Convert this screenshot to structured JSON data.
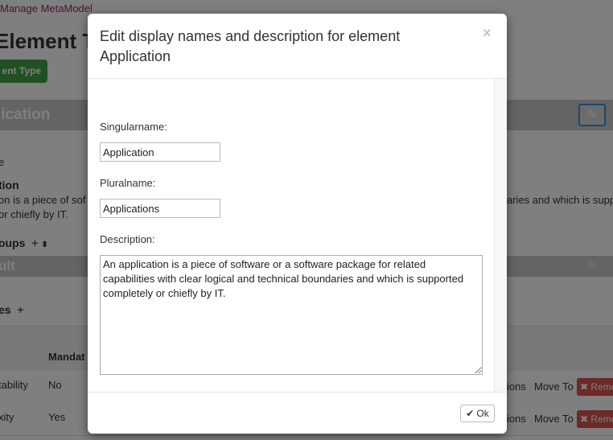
{
  "background": {
    "breadcrumb": "Manage MetaModel",
    "page_title": "Element Ty",
    "add_button_label": "ent Type",
    "section_header": "lication",
    "field_fragment_1": "e",
    "field_fragment_2": "tion",
    "description_line_1": "on is a piece of sof",
    "description_line_1_right": "aries and which is supp",
    "description_line_2": "or chiefly by IT.",
    "groups_label": "oups",
    "subsection_header": "ult",
    "attributes_label": "es",
    "table_header_mandatory": "Mandat",
    "rows": [
      {
        "name": "tability",
        "mandatory": "No",
        "actions": "ions",
        "move_to": "Move To",
        "remove": "Remo"
      },
      {
        "name": "xity",
        "mandatory": "Yes",
        "actions": "ions",
        "move_to": "Move To",
        "remove": "Remo"
      }
    ]
  },
  "modal": {
    "title": "Edit display names and description for element Application",
    "close_symbol": "×",
    "singular_label": "Singularname:",
    "singular_value": "Application",
    "plural_label": "Pluralname:",
    "plural_value": "Applications",
    "description_label": "Description:",
    "description_value": "An application is a piece of software or a software package for related capabilities with clear logical and technical boundaries and which is supported completely or chiefly by IT.",
    "ok_label": "Ok",
    "ok_icon": "check-icon"
  }
}
